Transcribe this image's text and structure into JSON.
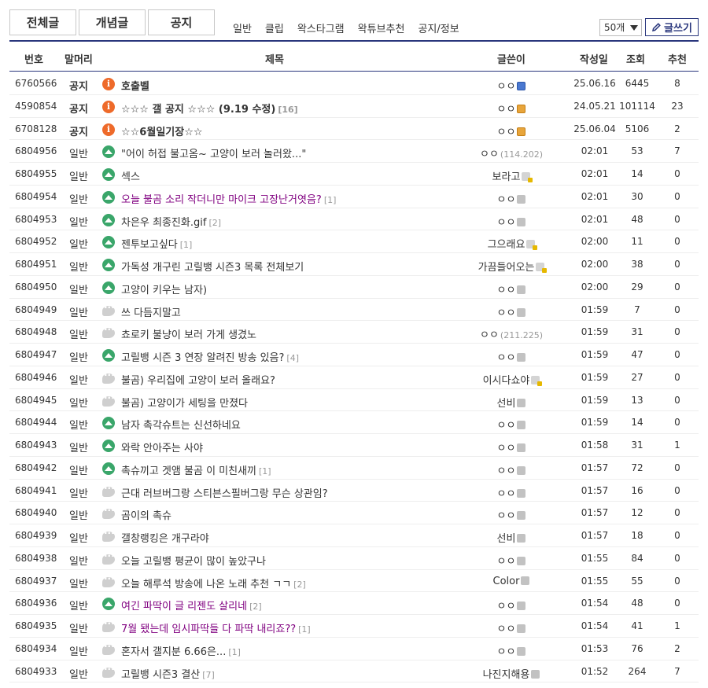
{
  "tabs": [
    {
      "label": "전체글",
      "active": true
    },
    {
      "label": "개념글",
      "active": false
    },
    {
      "label": "공지",
      "active": false
    }
  ],
  "categories": [
    "일반",
    "클립",
    "왁스타그램",
    "왁튜브추천",
    "공지/정보"
  ],
  "list_count": "50개",
  "write_label": "글쓰기",
  "columns": {
    "num": "번호",
    "head": "말머리",
    "title": "제목",
    "writer": "글쓴이",
    "date": "작성일",
    "views": "조회",
    "recommend": "추천"
  },
  "colors": {
    "accent": "#29367c",
    "notice_icon": "#ee6a2a",
    "image_icon": "#3aa66a",
    "visited_title": "#800080"
  },
  "rows": [
    {
      "num": "6760566",
      "head": "공지",
      "icon": "notice",
      "title": "호출벨",
      "comments": "",
      "writer": "ㅇㅇ",
      "ip": "",
      "badge": "blue",
      "date": "25.06.16",
      "views": "6445",
      "rec": "8",
      "notice": true,
      "purple": false
    },
    {
      "num": "4590854",
      "head": "공지",
      "icon": "notice",
      "title": "☆☆☆ 갤 공지 ☆☆☆ (9.19 수정)",
      "comments": "[16]",
      "writer": "ㅇㅇ",
      "ip": "",
      "badge": "gold",
      "date": "24.05.21",
      "views": "101114",
      "rec": "23",
      "notice": true,
      "purple": false
    },
    {
      "num": "6708128",
      "head": "공지",
      "icon": "notice",
      "title": "☆☆6월일기장☆☆",
      "comments": "",
      "writer": "ㅇㅇ",
      "ip": "",
      "badge": "gold",
      "date": "25.06.04",
      "views": "5106",
      "rec": "2",
      "notice": true,
      "purple": false
    },
    {
      "num": "6804956",
      "head": "일반",
      "icon": "image",
      "title": "\"어이 허접 불고옴~ 고양이 보러 놀러왔...\"",
      "comments": "",
      "writer": "ㅇㅇ",
      "ip": "(114.202)",
      "badge": "",
      "date": "02:01",
      "views": "53",
      "rec": "7",
      "notice": false,
      "purple": false
    },
    {
      "num": "6804955",
      "head": "일반",
      "icon": "image",
      "title": "섹스",
      "comments": "",
      "writer": "보라고",
      "ip": "",
      "badge": "lock",
      "date": "02:01",
      "views": "14",
      "rec": "0",
      "notice": false,
      "purple": false
    },
    {
      "num": "6804954",
      "head": "일반",
      "icon": "image",
      "title": " 오늘 불곰 소리 작더니만 마이크 고장난거엿음?",
      "comments": "[1]",
      "writer": "ㅇㅇ",
      "ip": "",
      "badge": "gray",
      "date": "02:01",
      "views": "30",
      "rec": "0",
      "notice": false,
      "purple": true
    },
    {
      "num": "6804953",
      "head": "일반",
      "icon": "image",
      "title": "차은우 최종진화.gif",
      "comments": "[2]",
      "writer": "ㅇㅇ",
      "ip": "",
      "badge": "gray",
      "date": "02:01",
      "views": "48",
      "rec": "0",
      "notice": false,
      "purple": false
    },
    {
      "num": "6804952",
      "head": "일반",
      "icon": "image",
      "title": "젠투보고싶다",
      "comments": "[1]",
      "writer": "그으래요",
      "ip": "",
      "badge": "lock",
      "date": "02:00",
      "views": "11",
      "rec": "0",
      "notice": false,
      "purple": false
    },
    {
      "num": "6804951",
      "head": "일반",
      "icon": "image",
      "title": "가독성 개구린 고릴뱅 시즌3 목록 전체보기",
      "comments": "",
      "writer": "가끔들어오는",
      "ip": "",
      "badge": "lock",
      "date": "02:00",
      "views": "38",
      "rec": "0",
      "notice": false,
      "purple": false
    },
    {
      "num": "6804950",
      "head": "일반",
      "icon": "image",
      "title": "고양이 키우는 남자)",
      "comments": "",
      "writer": "ㅇㅇ",
      "ip": "",
      "badge": "gray",
      "date": "02:00",
      "views": "29",
      "rec": "0",
      "notice": false,
      "purple": false
    },
    {
      "num": "6804949",
      "head": "일반",
      "icon": "text",
      "title": "쓰 다듬지말고",
      "comments": "",
      "writer": "ㅇㅇ",
      "ip": "",
      "badge": "gray",
      "date": "01:59",
      "views": "7",
      "rec": "0",
      "notice": false,
      "purple": false
    },
    {
      "num": "6804948",
      "head": "일반",
      "icon": "text",
      "title": "쵸로키 불냥이 보러 가게 생겼노",
      "comments": "",
      "writer": "ㅇㅇ",
      "ip": "(211.225)",
      "badge": "",
      "date": "01:59",
      "views": "31",
      "rec": "0",
      "notice": false,
      "purple": false
    },
    {
      "num": "6804947",
      "head": "일반",
      "icon": "image",
      "title": "고릴뱅 시즌 3 연장 알려진 방송 있음?",
      "comments": "[4]",
      "writer": "ㅇㅇ",
      "ip": "",
      "badge": "gray",
      "date": "01:59",
      "views": "47",
      "rec": "0",
      "notice": false,
      "purple": false
    },
    {
      "num": "6804946",
      "head": "일반",
      "icon": "text",
      "title": "불곰) 우리집에 고양이 보러 올래요?",
      "comments": "",
      "writer": "이시다쇼야",
      "ip": "",
      "badge": "lock",
      "date": "01:59",
      "views": "27",
      "rec": "0",
      "notice": false,
      "purple": false
    },
    {
      "num": "6804945",
      "head": "일반",
      "icon": "text",
      "title": "불곰) 고양이가 세팅을 만졌다",
      "comments": "",
      "writer": "선비",
      "ip": "",
      "badge": "gray",
      "date": "01:59",
      "views": "13",
      "rec": "0",
      "notice": false,
      "purple": false
    },
    {
      "num": "6804944",
      "head": "일반",
      "icon": "image",
      "title": "남자 촉각슈트는 신선하네요",
      "comments": "",
      "writer": "ㅇㅇ",
      "ip": "",
      "badge": "gray",
      "date": "01:59",
      "views": "14",
      "rec": "0",
      "notice": false,
      "purple": false
    },
    {
      "num": "6804943",
      "head": "일반",
      "icon": "image",
      "title": "와락 안아주는 사야",
      "comments": "",
      "writer": "ㅇㅇ",
      "ip": "",
      "badge": "gray",
      "date": "01:58",
      "views": "31",
      "rec": "1",
      "notice": false,
      "purple": false
    },
    {
      "num": "6804942",
      "head": "일반",
      "icon": "image",
      "title": "촉슈끼고 겟앰 불곰 이 미친새끼",
      "comments": "[1]",
      "writer": "ㅇㅇ",
      "ip": "",
      "badge": "gray",
      "date": "01:57",
      "views": "72",
      "rec": "0",
      "notice": false,
      "purple": false
    },
    {
      "num": "6804941",
      "head": "일반",
      "icon": "text",
      "title": "근대 러브버그랑 스티븐스필버그랑 무슨 상관임?",
      "comments": "",
      "writer": "ㅇㅇ",
      "ip": "",
      "badge": "gray",
      "date": "01:57",
      "views": "16",
      "rec": "0",
      "notice": false,
      "purple": false
    },
    {
      "num": "6804940",
      "head": "일반",
      "icon": "text",
      "title": "곰이의 촉슈",
      "comments": "",
      "writer": "ㅇㅇ",
      "ip": "",
      "badge": "gray",
      "date": "01:57",
      "views": "12",
      "rec": "0",
      "notice": false,
      "purple": false
    },
    {
      "num": "6804939",
      "head": "일반",
      "icon": "text",
      "title": "갤창랭킹은 개구라야",
      "comments": "",
      "writer": "선비",
      "ip": "",
      "badge": "gray",
      "date": "01:57",
      "views": "18",
      "rec": "0",
      "notice": false,
      "purple": false
    },
    {
      "num": "6804938",
      "head": "일반",
      "icon": "text",
      "title": "오늘 고릴뱅 평균이 많이 높았구나",
      "comments": "",
      "writer": "ㅇㅇ",
      "ip": "",
      "badge": "gray",
      "date": "01:55",
      "views": "84",
      "rec": "0",
      "notice": false,
      "purple": false
    },
    {
      "num": "6804937",
      "head": "일반",
      "icon": "text",
      "title": "오늘 해루석 방송에 나온 노래 추천 ㄱㄱ",
      "comments": "[2]",
      "writer": "Color",
      "ip": "",
      "badge": "gray",
      "date": "01:55",
      "views": "55",
      "rec": "0",
      "notice": false,
      "purple": false
    },
    {
      "num": "6804936",
      "head": "일반",
      "icon": "image",
      "title": "여긴 파딱이 글 리젠도 살리네",
      "comments": "[2]",
      "writer": "ㅇㅇ",
      "ip": "",
      "badge": "gray",
      "date": "01:54",
      "views": "48",
      "rec": "0",
      "notice": false,
      "purple": true
    },
    {
      "num": "6804935",
      "head": "일반",
      "icon": "text",
      "title": "7월 됐는데 임시파딱들 다 파딱 내리죠??",
      "comments": "[1]",
      "writer": "ㅇㅇ",
      "ip": "",
      "badge": "gray",
      "date": "01:54",
      "views": "41",
      "rec": "1",
      "notice": false,
      "purple": true
    },
    {
      "num": "6804934",
      "head": "일반",
      "icon": "text",
      "title": "혼자서 갤지분 6.66은...",
      "comments": "[1]",
      "writer": "ㅇㅇ",
      "ip": "",
      "badge": "gray",
      "date": "01:53",
      "views": "76",
      "rec": "2",
      "notice": false,
      "purple": false
    },
    {
      "num": "6804933",
      "head": "일반",
      "icon": "text",
      "title": "고릴뱅 시즌3 결산",
      "comments": "[7]",
      "writer": "나진지해용",
      "ip": "",
      "badge": "gray",
      "date": "01:52",
      "views": "264",
      "rec": "7",
      "notice": false,
      "purple": false
    }
  ]
}
